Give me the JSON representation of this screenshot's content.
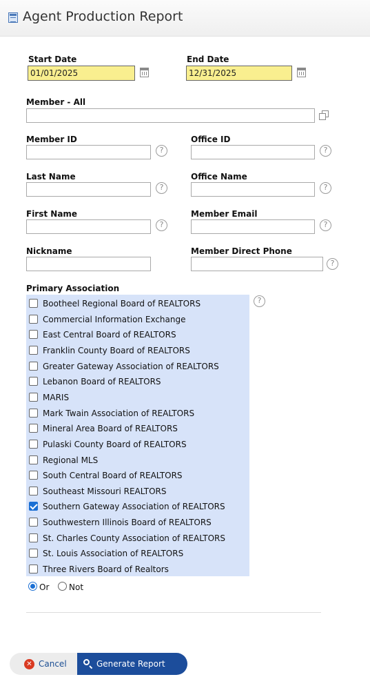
{
  "header": {
    "title": "Agent Production Report",
    "icon": "report-icon"
  },
  "dates": {
    "start_label": "Start Date",
    "start_value": "01/01/2025",
    "end_label": "End Date",
    "end_value": "12/31/2025"
  },
  "member": {
    "label": "Member - All",
    "value": ""
  },
  "fields": {
    "member_id": "Member ID",
    "office_id": "Office ID",
    "last_name": "Last Name",
    "office_name": "Office Name",
    "first_name": "First Name",
    "member_email": "Member Email",
    "nickname": "Nickname",
    "member_direct_phone": "Member Direct Phone"
  },
  "help_glyph": "?",
  "primary_association": {
    "label": "Primary Association",
    "items": [
      {
        "label": "Bootheel Regional Board of REALTORS",
        "checked": false
      },
      {
        "label": "Commercial Information Exchange",
        "checked": false
      },
      {
        "label": "East Central Board of REALTORS",
        "checked": false
      },
      {
        "label": "Franklin County Board of REALTORS",
        "checked": false
      },
      {
        "label": "Greater Gateway Association of REALTORS",
        "checked": false
      },
      {
        "label": "Lebanon Board of REALTORS",
        "checked": false
      },
      {
        "label": "MARIS",
        "checked": false
      },
      {
        "label": "Mark Twain Association of REALTORS",
        "checked": false
      },
      {
        "label": "Mineral Area Board of REALTORS",
        "checked": false
      },
      {
        "label": "Pulaski County Board of REALTORS",
        "checked": false
      },
      {
        "label": "Regional MLS",
        "checked": false
      },
      {
        "label": "South Central Board of REALTORS",
        "checked": false
      },
      {
        "label": "Southeast Missouri REALTORS",
        "checked": false
      },
      {
        "label": "Southern Gateway Association of REALTORS",
        "checked": true
      },
      {
        "label": "Southwestern Illinois Board of REALTORS",
        "checked": false
      },
      {
        "label": "St. Charles County Association of REALTORS",
        "checked": false
      },
      {
        "label": "St. Louis Association of REALTORS",
        "checked": false
      },
      {
        "label": "Three Rivers Board of Realtors",
        "checked": false
      }
    ],
    "mode_or": "Or",
    "mode_not": "Not",
    "selected_mode": "Or"
  },
  "buttons": {
    "cancel": "Cancel",
    "generate": "Generate Report"
  },
  "colors": {
    "accent": "#1c4d9b",
    "date_bg": "#f9ef8f",
    "list_bg": "#d7e3f9",
    "cancel_icon": "#d93a22"
  }
}
